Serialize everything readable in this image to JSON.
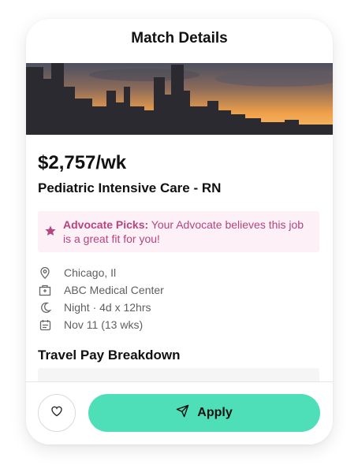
{
  "header": {
    "title": "Match Details"
  },
  "job": {
    "pay": "$2,757/wk",
    "title": "Pediatric Intensive Care - RN"
  },
  "advocate": {
    "label": "Advocate Picks:",
    "message": " Your Advocate believes this job is a great fit for you!",
    "icon": "star-icon"
  },
  "details": {
    "location": "Chicago, Il",
    "facility": "ABC Medical Center",
    "shift": "Night · 4d x 12hrs",
    "start": "Nov 11 (13 wks)"
  },
  "breakdown": {
    "title": "Travel Pay Breakdown"
  },
  "footer": {
    "apply_label": "Apply",
    "favorite_icon": "heart-icon",
    "apply_icon": "send-icon"
  },
  "colors": {
    "accent": "#4fdfb8",
    "advocate_bg": "#fdf0f6",
    "advocate_text": "#b5457f"
  }
}
